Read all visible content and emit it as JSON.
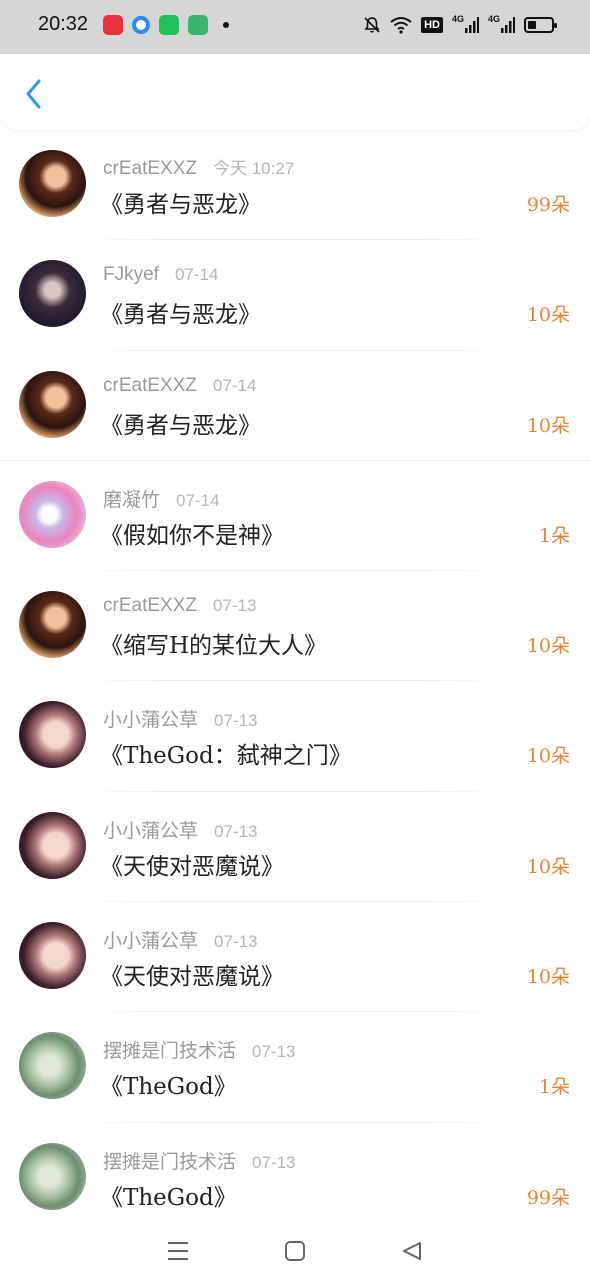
{
  "status_bar": {
    "time": "20:32",
    "app_icons": [
      {
        "name": "weibo-icon",
        "color": "#e8323c"
      },
      {
        "name": "browser-icon",
        "color": "#2d8cf0"
      },
      {
        "name": "chat-icon",
        "color": "#1ec15a"
      },
      {
        "name": "calendar-icon",
        "color": "#3bb56b"
      }
    ],
    "hd_label": "HD",
    "signal1_label": "4G",
    "signal2_label": "4G",
    "battery_level": 0.35
  },
  "header": {
    "back_icon": "chevron-left-icon",
    "accent": "#2d9be6"
  },
  "items": [
    {
      "user": "crEatEXXZ",
      "time": "今天 10:27",
      "title": "《勇者与恶龙》",
      "gift": "99朵",
      "avatar": "a1"
    },
    {
      "user": "FJkyef",
      "time": "07-14",
      "title": "《勇者与恶龙》",
      "gift": "10朵",
      "avatar": "a2"
    },
    {
      "user": "crEatEXXZ",
      "time": "07-14",
      "title": "《勇者与恶龙》",
      "gift": "10朵",
      "avatar": "a1"
    },
    {
      "user": "磨凝竹",
      "time": "07-14",
      "title": "《假如你不是神》",
      "gift": "1朵",
      "avatar": "a3"
    },
    {
      "user": "crEatEXXZ",
      "time": "07-13",
      "title": "《缩写H的某位大人》",
      "gift": "10朵",
      "avatar": "a1"
    },
    {
      "user": "小小蒲公草",
      "time": "07-13",
      "title": "《TheGod：弑神之门》",
      "gift": "10朵",
      "avatar": "a4"
    },
    {
      "user": "小小蒲公草",
      "time": "07-13",
      "title": "《天使对恶魔说》",
      "gift": "10朵",
      "avatar": "a4"
    },
    {
      "user": "小小蒲公草",
      "time": "07-13",
      "title": "《天使对恶魔说》",
      "gift": "10朵",
      "avatar": "a4"
    },
    {
      "user": "摆摊是门技术活",
      "time": "07-13",
      "title": "《TheGod》",
      "gift": "1朵",
      "avatar": "a5"
    },
    {
      "user": "摆摊是门技术活",
      "time": "07-13",
      "title": "《TheGod》",
      "gift": "99朵",
      "avatar": "a5"
    }
  ],
  "colors": {
    "gift": "#e8833a",
    "username": "#9a9a9a",
    "time": "#b5b5b5",
    "title": "#222222"
  },
  "nav": {
    "menu_icon": "menu-icon",
    "home_icon": "square-icon",
    "back_icon": "triangle-back-icon"
  }
}
